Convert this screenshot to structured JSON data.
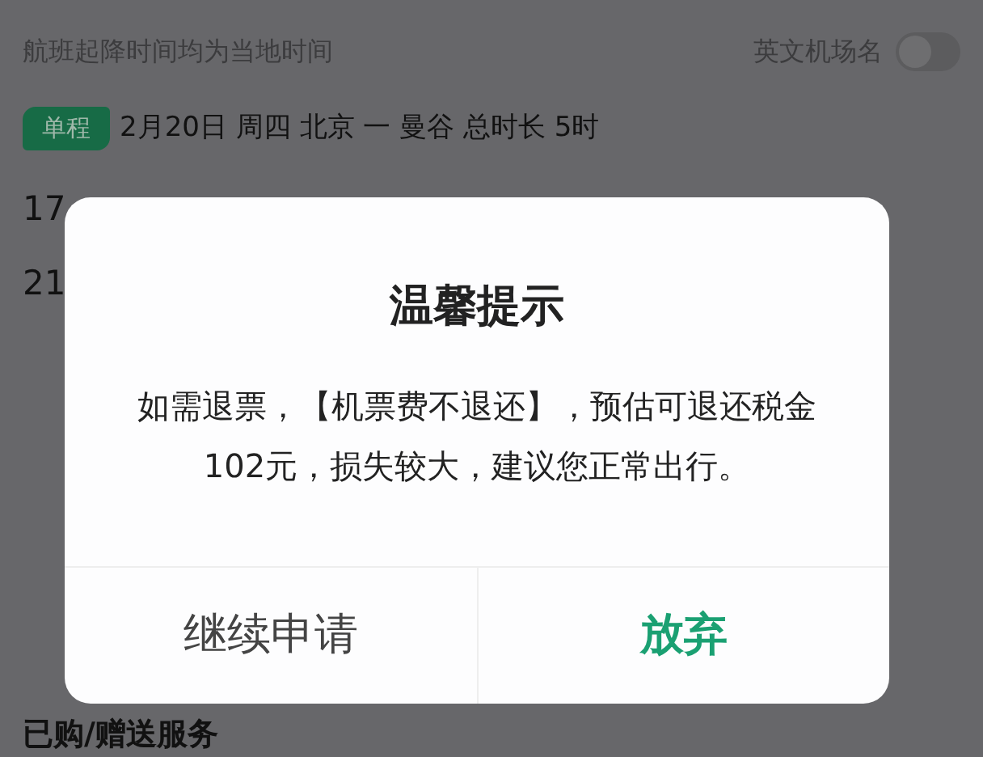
{
  "header": {
    "note": "航班起降时间均为当地时间",
    "toggle_label": "英文机场名",
    "toggle_on": false
  },
  "trip": {
    "badge": "单程",
    "summary": "2月20日 周四 北京 一 曼谷 总时长 5时"
  },
  "times": [
    "17",
    "21"
  ],
  "section_title": "已购/赠送服务",
  "dialog": {
    "title": "温馨提示",
    "message": "如需退票，【机票费不退还】，预估可退还税金102元，损失较大，建议您正常出行。",
    "buttons": [
      {
        "label": "继续申请",
        "kind": "secondary"
      },
      {
        "label": "放弃",
        "kind": "primary"
      }
    ]
  }
}
